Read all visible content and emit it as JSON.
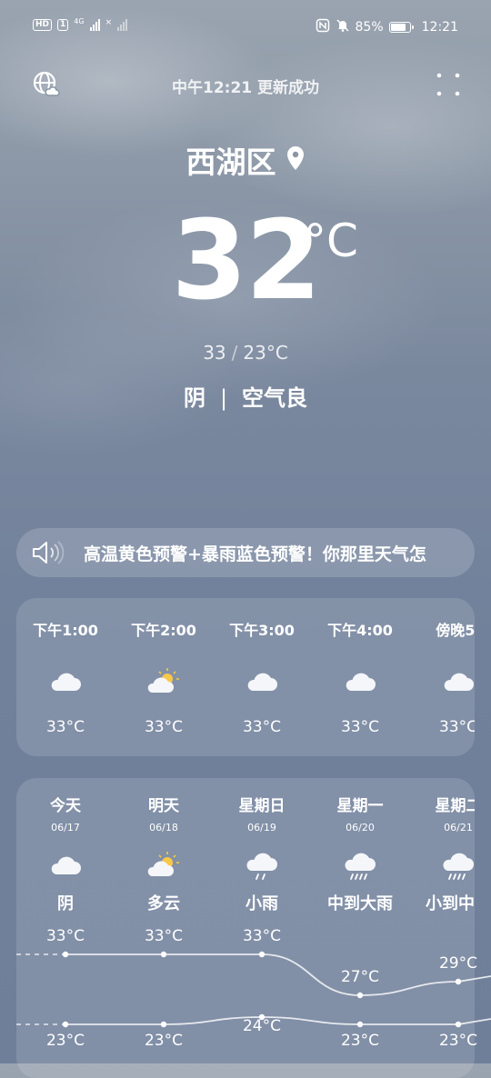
{
  "status_bar": {
    "left_chips": [
      "HD",
      "1"
    ],
    "network": "4G",
    "no_sim_mark": "×",
    "battery_text": "85%",
    "battery_level": 0.85,
    "time": "12:21",
    "icons": [
      "nfc-icon",
      "bell-off-icon"
    ]
  },
  "header": {
    "update_text": "中午12:21 更新成功",
    "location_name": "西湖区",
    "left_icon": "globe-cloud-icon",
    "right_icon": "four-dots-menu-icon"
  },
  "current": {
    "temp": "32",
    "unit": "°C",
    "high": "33",
    "low": "23°C",
    "hilo_sep": "/",
    "condition": "阴",
    "divider": "|",
    "air_quality": "空气良"
  },
  "alert": {
    "icon": "speaker-icon",
    "text": "高温黄色预警+暴雨蓝色预警！你那里天气怎"
  },
  "hourly": [
    {
      "time": "下午1:00",
      "icon": "cloud",
      "temp": "33°C"
    },
    {
      "time": "下午2:00",
      "icon": "sun-cloud",
      "temp": "33°C"
    },
    {
      "time": "下午3:00",
      "icon": "cloud",
      "temp": "33°C"
    },
    {
      "time": "下午4:00",
      "icon": "cloud",
      "temp": "33°C"
    },
    {
      "time": "傍晚5:",
      "icon": "cloud",
      "temp": "33°C"
    }
  ],
  "daily": [
    {
      "day": "今天",
      "date": "06/17",
      "icon": "cloud",
      "cond": "阴",
      "high": "33°C",
      "low": "23°C",
      "high_val": 33,
      "low_val": 23
    },
    {
      "day": "明天",
      "date": "06/18",
      "icon": "sun-cloud",
      "cond": "多云",
      "high": "33°C",
      "low": "23°C",
      "high_val": 33,
      "low_val": 23
    },
    {
      "day": "星期日",
      "date": "06/19",
      "icon": "light-rain",
      "cond": "小雨",
      "high": "33°C",
      "low": "24°C",
      "high_val": 33,
      "low_val": 24
    },
    {
      "day": "星期一",
      "date": "06/20",
      "icon": "heavy-rain",
      "cond": "中到大雨",
      "high": "27°C",
      "low": "23°C",
      "high_val": 27,
      "low_val": 23
    },
    {
      "day": "星期二",
      "date": "06/21",
      "icon": "heavy-rain",
      "cond": "小到中雨",
      "high": "29°C",
      "low": "23°C",
      "high_val": 29,
      "low_val": 23
    }
  ],
  "colors": {
    "sun": "#f7c948",
    "cloud": "#f4f6f9",
    "rain": "#ffffff"
  }
}
